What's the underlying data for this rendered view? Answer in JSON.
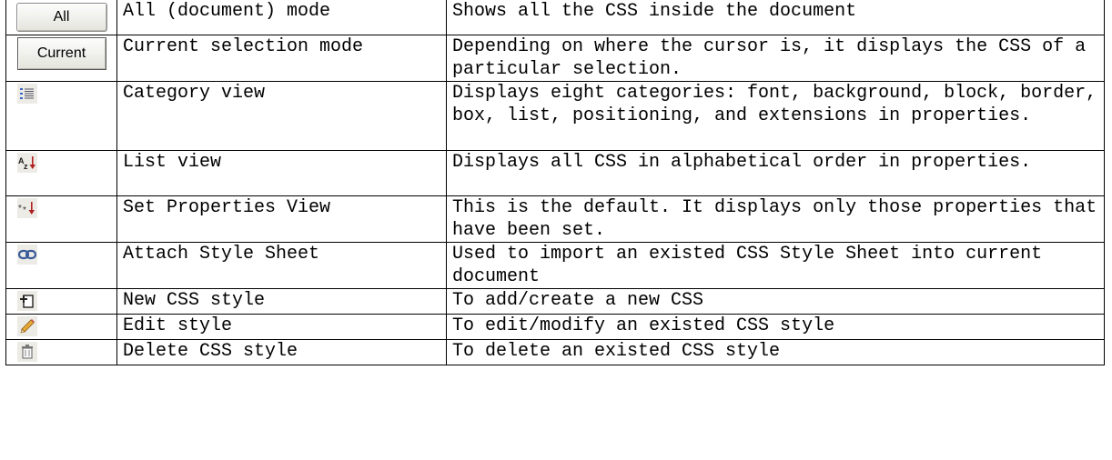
{
  "icons": {
    "all_label": "All",
    "current_label": "Current",
    "accent_blue": "#3a66c4",
    "accent_red": "#b02020"
  },
  "rows": [
    {
      "icon": "all-mode-button",
      "name": "All (document) mode",
      "desc": "Shows all the CSS inside the document"
    },
    {
      "icon": "current-mode-button",
      "name": "Current selection mode",
      "desc": "Depending on where the cursor is, it displays the CSS of a particular selection."
    },
    {
      "icon": "category-view-icon",
      "name": "Category view",
      "desc": "Displays eight categories: font, background, block, border, box, list, positioning, and extensions in properties."
    },
    {
      "icon": "list-view-icon",
      "name": "List view",
      "desc": "Displays all CSS in alphabetical order in properties."
    },
    {
      "icon": "set-properties-icon",
      "name": "Set Properties View",
      "desc": "This is the default. It displays only those properties that have been set."
    },
    {
      "icon": "attach-style-sheet-icon",
      "name": "Attach Style Sheet",
      "desc": "Used to import an existed CSS Style Sheet into current document"
    },
    {
      "icon": "new-css-style-icon",
      "name": "New CSS style",
      "desc": "To add/create a new CSS"
    },
    {
      "icon": "edit-style-icon",
      "name": "Edit style",
      "desc": "To edit/modify an existed CSS style"
    },
    {
      "icon": "delete-css-style-icon",
      "name": "Delete CSS style",
      "desc": "To delete an existed CSS style"
    }
  ]
}
